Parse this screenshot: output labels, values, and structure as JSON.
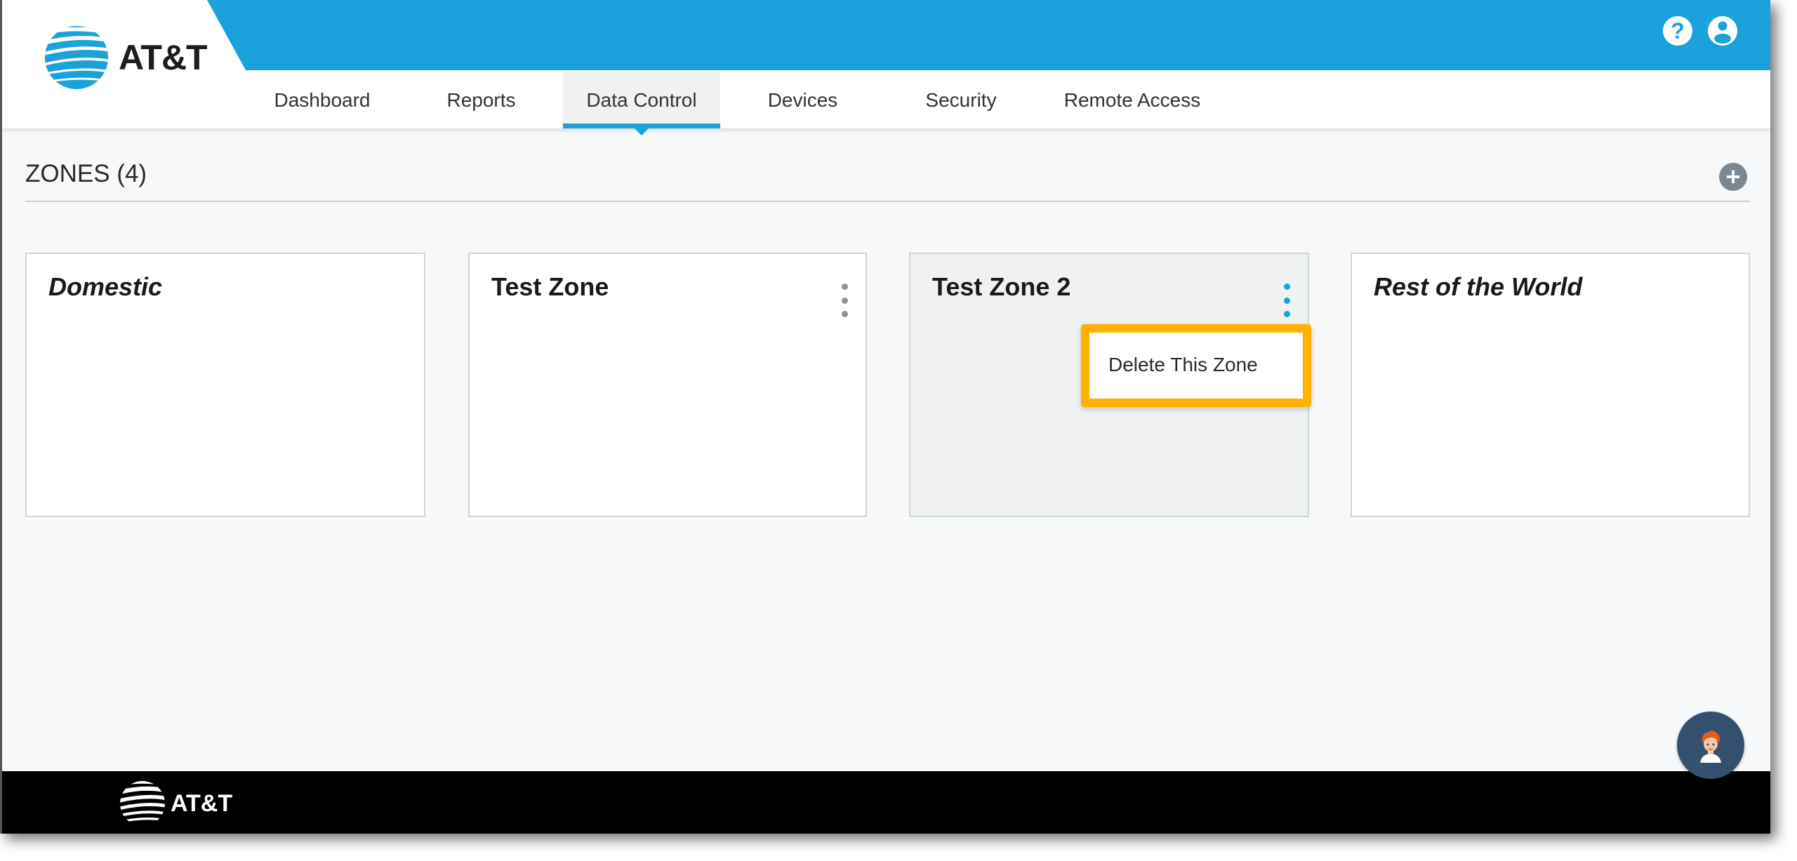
{
  "header": {
    "brand": "AT&T",
    "help_icon": "question-circle-icon",
    "user_icon": "user-circle-icon",
    "brand_color": "#1ba1db"
  },
  "nav": {
    "tabs": [
      {
        "label": "Dashboard",
        "active": false
      },
      {
        "label": "Reports",
        "active": false
      },
      {
        "label": "Data Control",
        "active": true
      },
      {
        "label": "Devices",
        "active": false
      },
      {
        "label": "Security",
        "active": false
      },
      {
        "label": "Remote Access",
        "active": false
      }
    ]
  },
  "zones": {
    "title": "ZONES (4)",
    "add_icon": "plus-circle-icon",
    "cards": [
      {
        "title": "Domestic",
        "italic": true,
        "has_menu": false
      },
      {
        "title": "Test Zone",
        "italic": false,
        "has_menu": true
      },
      {
        "title": "Test Zone 2",
        "italic": false,
        "has_menu": true,
        "menu_open": true
      },
      {
        "title": "Rest of the World",
        "italic": true,
        "has_menu": false
      }
    ],
    "menu": {
      "items": [
        {
          "label": "Delete This Zone"
        }
      ],
      "highlight_color": "#ffb000"
    }
  },
  "footer": {
    "brand": "AT&T"
  },
  "chat": {
    "icon": "chat-assistant-avatar-icon"
  }
}
